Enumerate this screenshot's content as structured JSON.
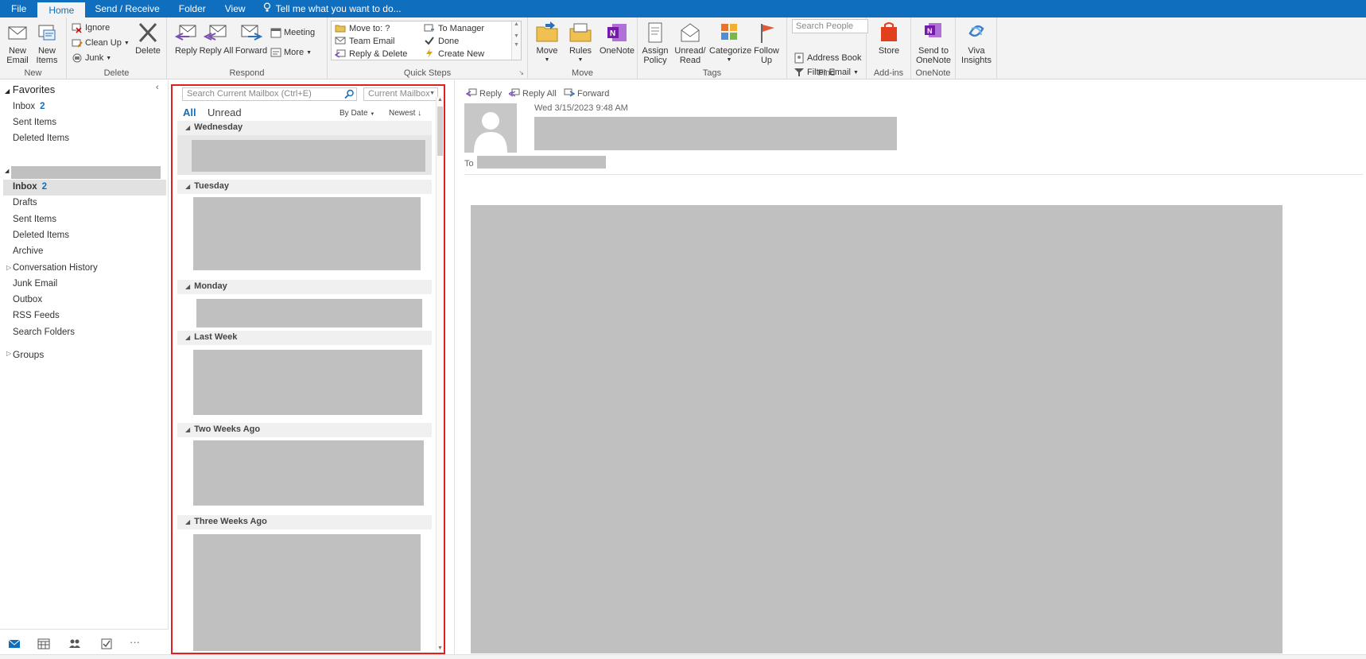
{
  "menu": {
    "tabs": [
      "File",
      "Home",
      "Send / Receive",
      "Folder",
      "View"
    ],
    "active_tab": "Home",
    "tell_me": "Tell me what you want to do..."
  },
  "ribbon": {
    "new": {
      "label": "New",
      "new_email": "New Email",
      "new_items": "New Items"
    },
    "delete": {
      "label": "Delete",
      "ignore": "Ignore",
      "clean_up": "Clean Up",
      "junk": "Junk",
      "delete": "Delete"
    },
    "respond": {
      "label": "Respond",
      "reply": "Reply",
      "reply_all": "Reply All",
      "forward": "Forward",
      "meeting": "Meeting",
      "more": "More"
    },
    "quick_steps": {
      "label": "Quick Steps",
      "move_to": "Move to: ?",
      "team_email": "Team Email",
      "reply_delete": "Reply & Delete",
      "to_manager": "To Manager",
      "done": "Done",
      "create_new": "Create New"
    },
    "move": {
      "label": "Move",
      "move": "Move",
      "rules": "Rules",
      "onenote": "OneNote"
    },
    "tags": {
      "label": "Tags",
      "assign_policy": "Assign Policy",
      "unread_read": "Unread/ Read",
      "categorize": "Categorize",
      "follow_up": "Follow Up"
    },
    "find": {
      "label": "Find",
      "search_people": "Search People",
      "address_book": "Address Book",
      "filter_email": "Filter Email"
    },
    "addins": {
      "label": "Add-ins",
      "store": "Store"
    },
    "onenote_group": {
      "label": "OneNote",
      "send_to_onenote": "Send to OneNote"
    },
    "viva": {
      "viva_insights": "Viva Insights"
    }
  },
  "nav": {
    "favorites_label": "Favorites",
    "favorites": [
      {
        "label": "Inbox",
        "count": "2"
      },
      {
        "label": "Sent Items",
        "count": ""
      },
      {
        "label": "Deleted Items",
        "count": ""
      }
    ],
    "folders": [
      {
        "label": "Inbox",
        "count": "2"
      },
      {
        "label": "Drafts",
        "count": ""
      },
      {
        "label": "Sent Items",
        "count": ""
      },
      {
        "label": "Deleted Items",
        "count": ""
      },
      {
        "label": "Archive",
        "count": ""
      },
      {
        "label": "Conversation History",
        "count": ""
      },
      {
        "label": "Junk Email",
        "count": ""
      },
      {
        "label": "Outbox",
        "count": ""
      },
      {
        "label": "RSS Feeds",
        "count": ""
      },
      {
        "label": "Search Folders",
        "count": ""
      }
    ],
    "groups_label": "Groups"
  },
  "message_list": {
    "search_placeholder": "Search Current Mailbox (Ctrl+E)",
    "scope": "Current Mailbox",
    "filter_all": "All",
    "filter_unread": "Unread",
    "sort_by": "By Date",
    "sort_order": "Newest",
    "groups": [
      "Wednesday",
      "Tuesday",
      "Monday",
      "Last Week",
      "Two Weeks Ago",
      "Three Weeks Ago"
    ]
  },
  "reading_pane": {
    "reply": "Reply",
    "reply_all": "Reply All",
    "forward": "Forward",
    "date": "Wed 3/15/2023 9:48 AM",
    "to_label": "To"
  },
  "colors": {
    "accent": "#106ebe",
    "highlight_border": "#e02020",
    "redacted": "#c0c0c0"
  }
}
